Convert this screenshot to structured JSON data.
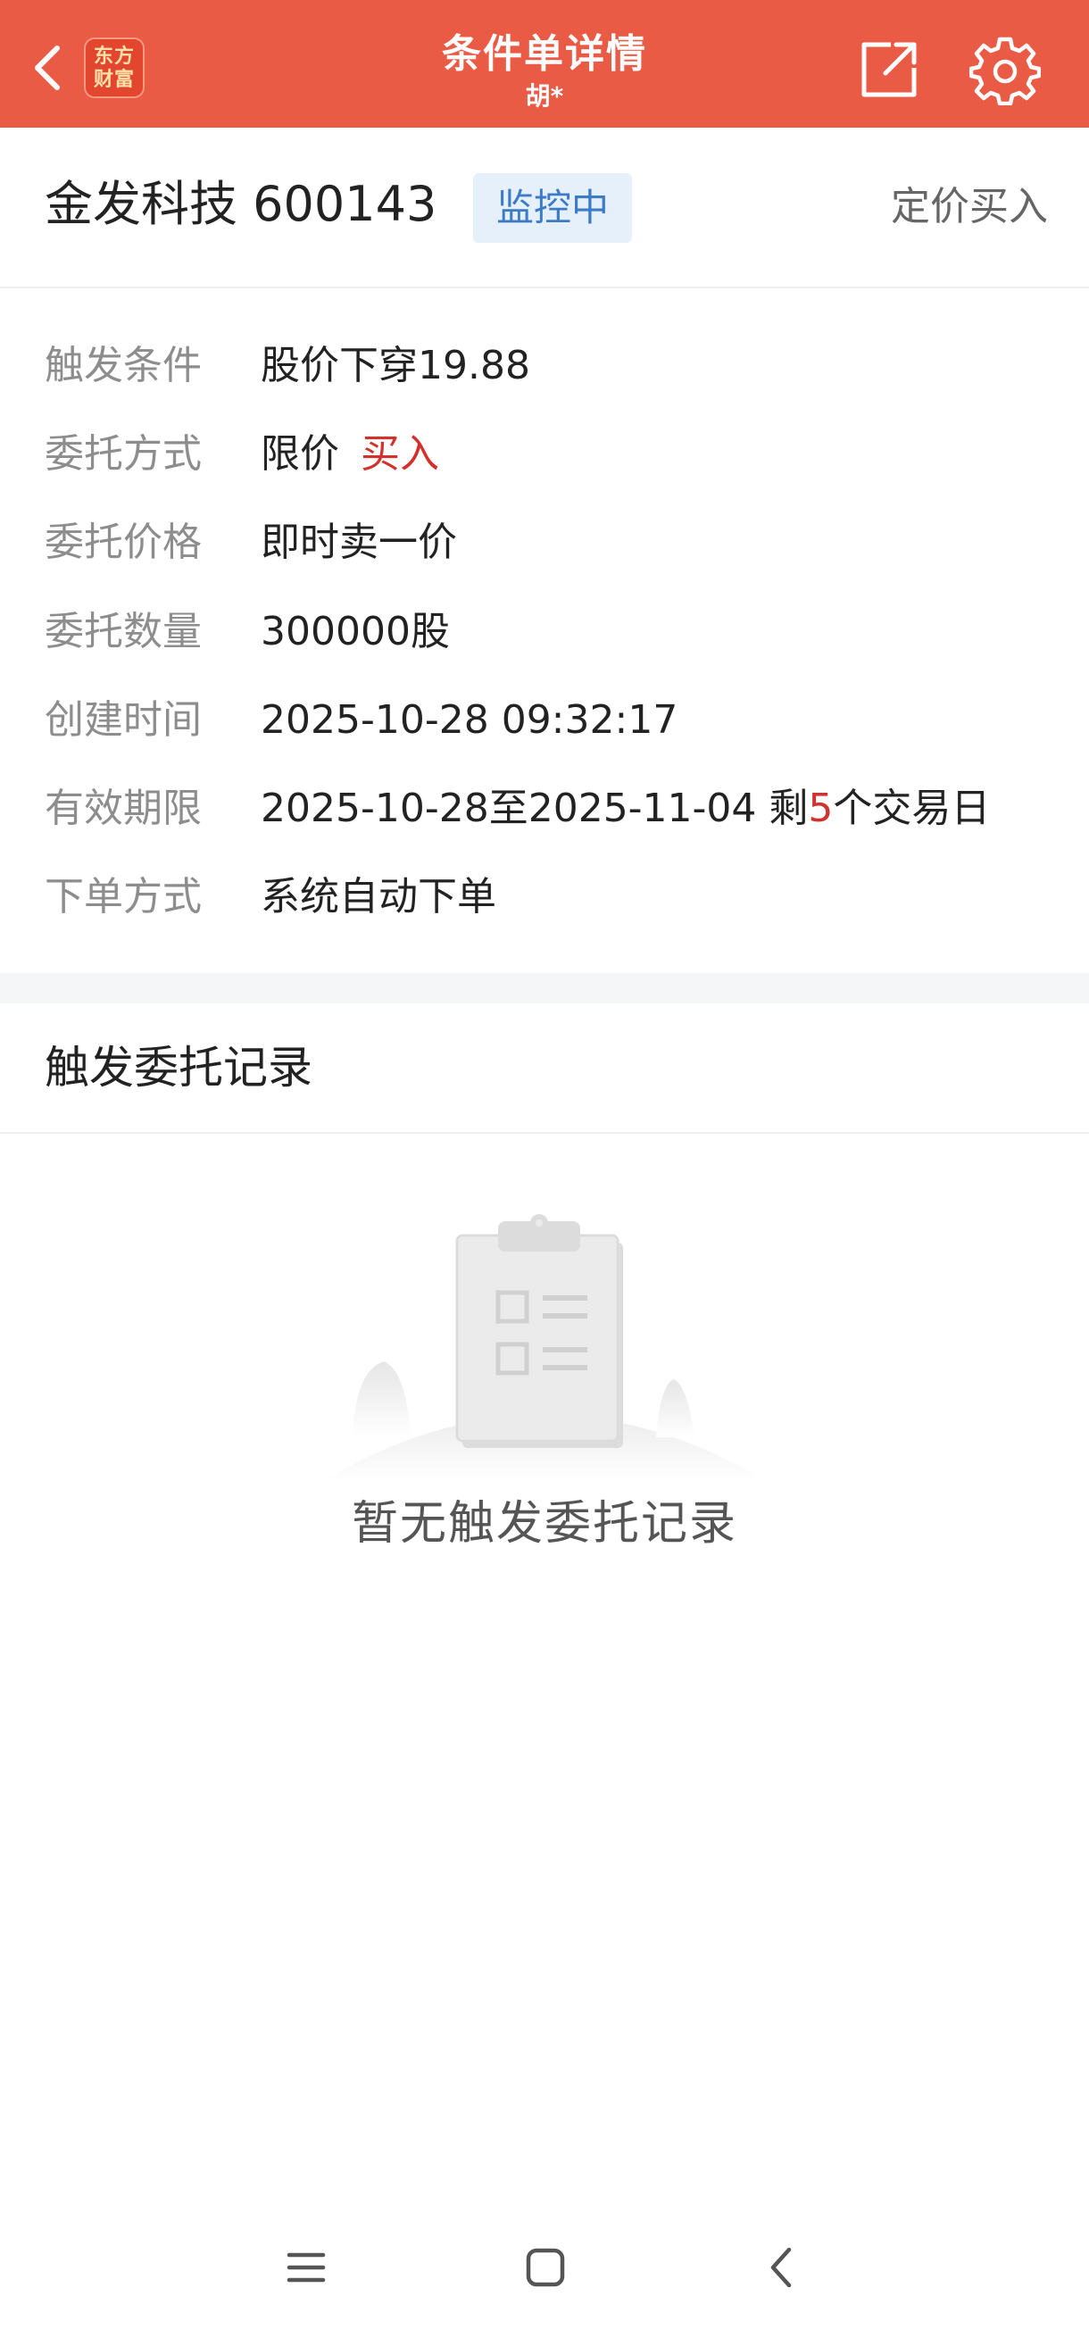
{
  "header": {
    "title": "条件单详情",
    "subtitle": "胡*",
    "logo_line1": "东方",
    "logo_line2": "财富",
    "background_color": "#EA5B45"
  },
  "stock": {
    "name_code": "金发科技 600143",
    "status": "监控中",
    "order_type": "定价买入"
  },
  "details": {
    "trigger_label": "触发条件",
    "trigger_value": "股价下穿19.88",
    "method_label": "委托方式",
    "method_price_type": "限价",
    "method_direction": "买入",
    "price_label": "委托价格",
    "price_value": "即时卖一价",
    "qty_label": "委托数量",
    "qty_value": "300000股",
    "created_label": "创建时间",
    "created_value": "2025-10-28 09:32:17",
    "validity_label": "有效期限",
    "validity_range": "2025-10-28至2025-11-04 剩",
    "validity_days": "5",
    "validity_suffix": "个交易日",
    "order_mode_label": "下单方式",
    "order_mode_value": "系统自动下单"
  },
  "records": {
    "title": "触发委托记录",
    "empty_text": "暂无触发委托记录"
  },
  "colors": {
    "accent": "#EA5B45",
    "buy_red": "#D2322B",
    "status_blue": "#3D7BC7",
    "status_bg": "#E6F0FB"
  },
  "icons": {
    "back": "chevron-left-icon",
    "share": "share-icon",
    "settings": "gear-icon",
    "empty": "clipboard-icon",
    "nav_menu": "menu-icon",
    "nav_home": "home-square-icon",
    "nav_back": "back-icon"
  }
}
